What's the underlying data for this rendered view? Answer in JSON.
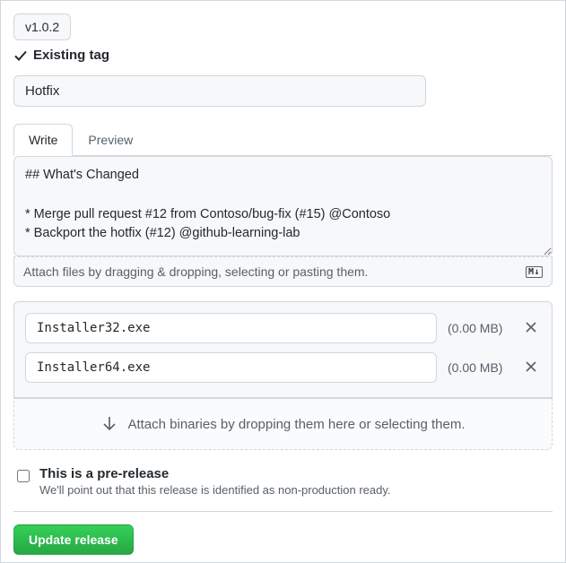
{
  "tag": {
    "value": "v1.0.2",
    "status": "Existing tag"
  },
  "title": {
    "value": "Hotfix"
  },
  "tabs": {
    "write": "Write",
    "preview": "Preview"
  },
  "description": {
    "value": "## What's Changed\n\n* Merge pull request #12 from Contoso/bug-fix (#15) @Contoso\n* Backport the hotfix (#12) @github-learning-lab",
    "attach_hint": "Attach files by dragging & dropping, selecting or pasting them."
  },
  "binaries": {
    "items": [
      {
        "name": "Installer32.exe",
        "size": "(0.00 MB)"
      },
      {
        "name": "Installer64.exe",
        "size": "(0.00 MB)"
      }
    ],
    "drop_hint": "Attach binaries by dropping them here or selecting them."
  },
  "prerelease": {
    "label": "This is a pre-release",
    "hint": "We'll point out that this release is identified as non-production ready."
  },
  "actions": {
    "update": "Update release"
  }
}
